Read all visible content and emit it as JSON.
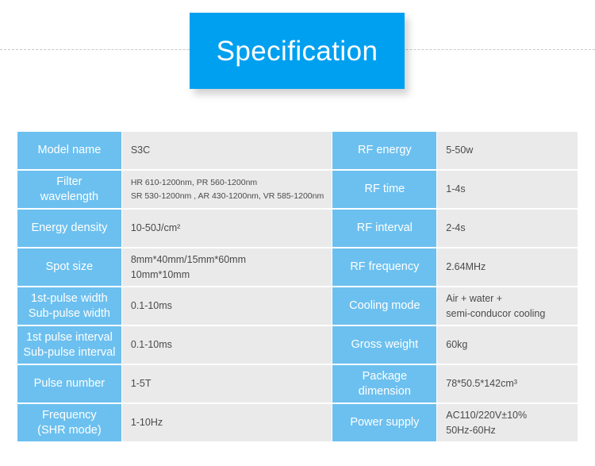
{
  "page": {
    "background_color": "#ffffff",
    "banner_color": "#00a0f0",
    "label_color": "#6cc0ef",
    "value_background": "#eaeaea",
    "value_text_color": "#4a4a4a"
  },
  "banner": {
    "title": "Specification"
  },
  "table": {
    "rows": [
      {
        "label_left": "Model name",
        "value_left": [
          "S3C"
        ],
        "label_right": "RF energy",
        "value_right": [
          "5-50w"
        ]
      },
      {
        "label_left": "Filter\nwavelength",
        "label_left_lines": [
          "Filter",
          "wavelength"
        ],
        "value_left": [
          "HR 610-1200nm,  PR 560-1200nm",
          "SR 530-1200nm ,  AR 430-1200nm, VR 585-1200nm"
        ],
        "value_left_small": true,
        "label_right": "RF time",
        "value_right": [
          "1-4s"
        ]
      },
      {
        "label_left": "Energy density",
        "value_left": [
          "10-50J/cm²"
        ],
        "label_right": "RF interval",
        "value_right": [
          "2-4s"
        ]
      },
      {
        "label_left": "Spot size",
        "value_left": [
          "8mm*40mm/15mm*60mm",
          "10mm*10mm"
        ],
        "label_right": "RF frequency",
        "value_right": [
          "2.64MHz"
        ]
      },
      {
        "label_left_lines": [
          "1st-pulse width",
          "Sub-pulse width"
        ],
        "value_left": [
          "0.1-10ms"
        ],
        "label_right": "Cooling mode",
        "value_right": [
          "Air + water +",
          "semi-conducor cooling"
        ]
      },
      {
        "label_left_lines": [
          "1st pulse interval",
          "Sub-pulse interval"
        ],
        "value_left": [
          "0.1-10ms"
        ],
        "label_right": "Gross weight",
        "value_right": [
          "60kg"
        ]
      },
      {
        "label_left": "Pulse number",
        "value_left": [
          "1-5T"
        ],
        "label_right_lines": [
          "Package",
          "dimension"
        ],
        "value_right": [
          "78*50.5*142cm³"
        ]
      },
      {
        "label_left_lines": [
          "Frequency",
          "(SHR mode)"
        ],
        "value_left": [
          "1-10Hz"
        ],
        "label_right": "Power supply",
        "value_right": [
          "AC110/220V±10%",
          "50Hz-60Hz"
        ]
      }
    ]
  }
}
